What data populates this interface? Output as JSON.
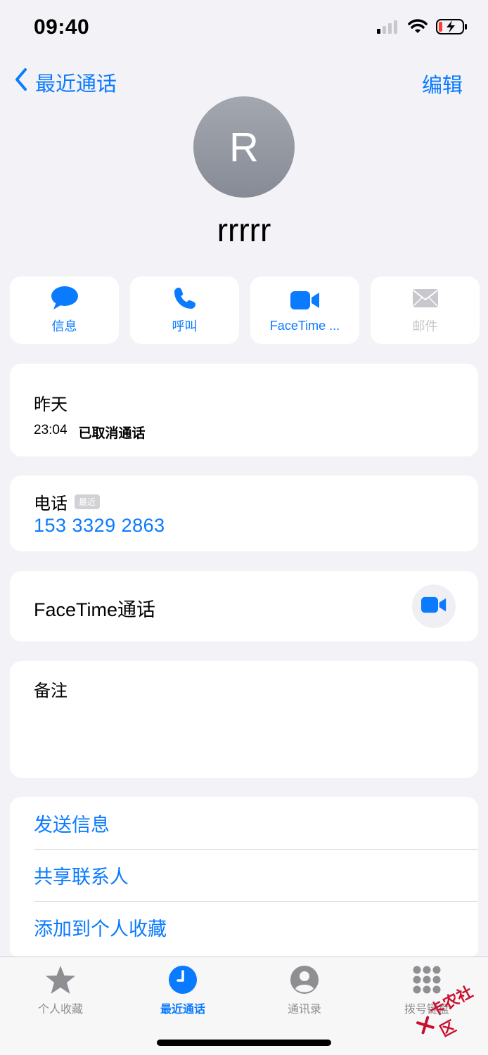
{
  "status_bar": {
    "time": "09:40",
    "icons": [
      "cellular-signal-icon",
      "wifi-icon",
      "battery-charging-icon"
    ]
  },
  "nav": {
    "back_label": "最近通话",
    "edit_label": "编辑"
  },
  "contact": {
    "initial": "R",
    "name": "rrrrr"
  },
  "actions": [
    {
      "label": "信息",
      "icon": "message-bubble-icon",
      "enabled": true
    },
    {
      "label": "呼叫",
      "icon": "phone-icon",
      "enabled": true
    },
    {
      "label": "FaceTime ...",
      "icon": "video-camera-icon",
      "enabled": true
    },
    {
      "label": "邮件",
      "icon": "envelope-icon",
      "enabled": false
    }
  ],
  "recent_call": {
    "day": "昨天",
    "time": "23:04",
    "status": "已取消通话"
  },
  "phone": {
    "label": "电话",
    "badge": "最近",
    "number": "153 3329 2863"
  },
  "facetime": {
    "label": "FaceTime通话",
    "icon": "video-camera-icon"
  },
  "notes": {
    "label": "备注"
  },
  "links": [
    {
      "label": "发送信息"
    },
    {
      "label": "共享联系人"
    },
    {
      "label": "添加到个人收藏"
    }
  ],
  "tabbar": {
    "tabs": [
      {
        "label": "个人收藏",
        "icon": "star-icon",
        "active": false
      },
      {
        "label": "最近通话",
        "icon": "clock-icon",
        "active": true
      },
      {
        "label": "通讯录",
        "icon": "person-circle-icon",
        "active": false
      },
      {
        "label": "拨号键盘",
        "icon": "keypad-icon",
        "active": false
      }
    ]
  },
  "watermark": {
    "text": "卡农社区"
  },
  "colors": {
    "accent": "#0a7aff",
    "background": "#f2f2f7",
    "card": "#ffffff",
    "inactive": "#8e8e93"
  }
}
